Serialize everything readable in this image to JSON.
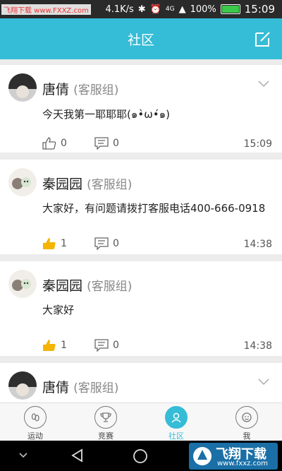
{
  "status_bar": {
    "watermark": "飞翔下载 www.FXXZ.com",
    "speed": "4.1K/s",
    "network": "4G",
    "battery": "100%",
    "battery_level": 1.0,
    "time": "15:09"
  },
  "header": {
    "title": "社区"
  },
  "posts": [
    {
      "name": "唐倩",
      "group": "(客服组)",
      "content": "今天我第一耶耶耶(๑•̀ω•́๑)",
      "likes": "0",
      "comments": "0",
      "time": "15:09"
    },
    {
      "name": "秦园园",
      "group": "(客服组)",
      "content": "大家好，有问题请拨打客服电话400-666-0918",
      "likes": "1",
      "comments": "0",
      "time": "14:38"
    },
    {
      "name": "秦园园",
      "group": "(客服组)",
      "content": "大家好",
      "likes": "1",
      "comments": "0",
      "time": "14:38"
    },
    {
      "name": "唐倩",
      "group": "(客服组)"
    }
  ],
  "tabs": [
    {
      "label": "运动"
    },
    {
      "label": "竞赛"
    },
    {
      "label": "社区"
    },
    {
      "label": "我"
    }
  ],
  "watermark_bottom": {
    "text": "飞翔下载",
    "url": "www.fxxz.com"
  },
  "colors": {
    "accent": "#35bcd6",
    "like_active": "#f5b400"
  }
}
